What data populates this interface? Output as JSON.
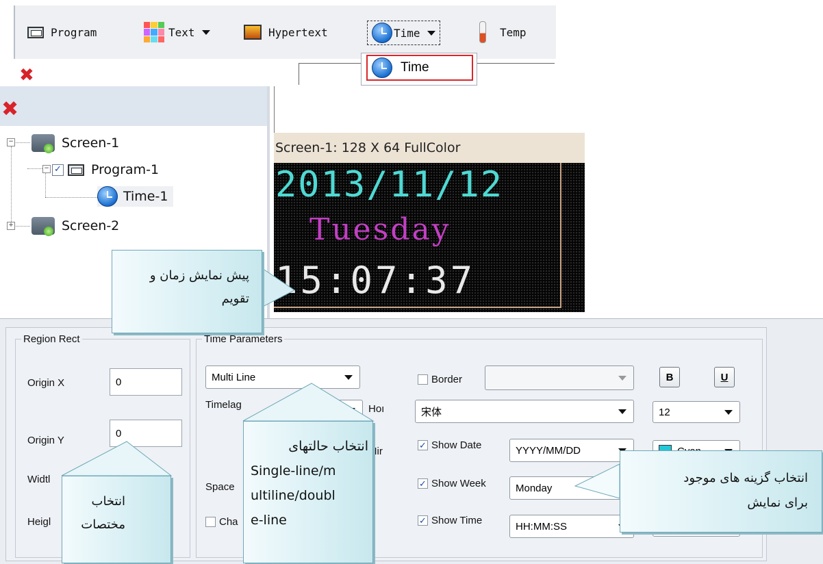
{
  "toolbar": {
    "program": "Program",
    "text": "Text",
    "hypertext": "Hypertext",
    "time": "Time",
    "temp": "Temp"
  },
  "dropdown": {
    "item": "Time"
  },
  "tree": {
    "screen1": "Screen-1",
    "program1": "Program-1",
    "time1": "Time-1",
    "screen2": "Screen-2"
  },
  "preview": {
    "header": "Screen-1: 128 X 64 FullColor",
    "date": "2013/11/12",
    "week": "Tuesday",
    "time": "15:07:37"
  },
  "region_rect": {
    "legend": "Region Rect",
    "origin_x_label": "Origin X",
    "origin_x_value": "0",
    "origin_y_label": "Origin Y",
    "origin_y_value": "0",
    "width_label": "Widtl",
    "height_label": "Heigl"
  },
  "time_params": {
    "legend": "Time Parameters",
    "mode": "Multi Line",
    "timelag_label": "Timelag",
    "hou_label": "Hoı",
    "min_label": "Mir",
    "space_label": "Space",
    "cha_label": "Cha",
    "border_label": "Border",
    "font": "宋体",
    "font_size": "12",
    "bold": "B",
    "underline": "U",
    "show_date": "Show Date",
    "date_format": "YYYY/MM/DD",
    "date_color": "Cyan",
    "show_week": "Show Week",
    "week_format": "Monday",
    "show_time": "Show Time",
    "time_format": "HH:MM:SS"
  },
  "callouts": {
    "preview_l1": "پیش نمایش زمان و",
    "preview_l2": "تقویم",
    "coords_l1": "انتخاب",
    "coords_l2": "مختصات",
    "mode_l1": "انتخاب حالتهای",
    "mode_l2": "Single-line/m",
    "mode_l3": "ultiline/doubl",
    "mode_l4": "e-line",
    "options_l1": "انتخاب گزینه های موجود",
    "options_l2": "برای نمایش"
  },
  "colors": {
    "accent_red": "#d8232a",
    "cyan": "#22c8d8",
    "led_cyan": "#4fd9d3",
    "led_magenta": "#c33fc4"
  }
}
